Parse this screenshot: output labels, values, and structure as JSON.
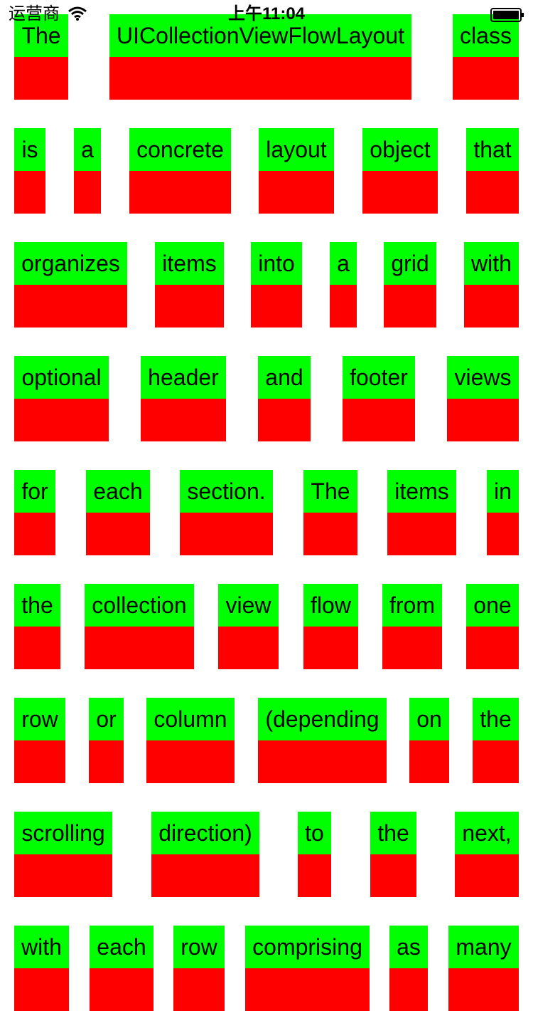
{
  "status_bar": {
    "carrier": "运营商",
    "time": "上午11:04",
    "wifi_icon": "wifi-icon",
    "battery_icon": "battery-icon"
  },
  "collection": {
    "top_color": "#00ff00",
    "bottom_color": "#ff0000",
    "rows": [
      [
        "The",
        "UICollectionViewFlowLayout",
        "class"
      ],
      [
        "is",
        "a",
        "concrete",
        "layout",
        "object",
        "that"
      ],
      [
        "organizes",
        "items",
        "into",
        "a",
        "grid",
        "with"
      ],
      [
        "optional",
        "header",
        "and",
        "footer",
        "views"
      ],
      [
        "for",
        "each",
        "section.",
        "The",
        "items",
        "in"
      ],
      [
        "the",
        "collection",
        "view",
        "flow",
        "from",
        "one"
      ],
      [
        "row",
        "or",
        "column",
        "(depending",
        "on",
        "the"
      ],
      [
        "scrolling",
        "direction)",
        "to",
        "the",
        "next,"
      ],
      [
        "with",
        "each",
        "row",
        "comprising",
        "as",
        "many"
      ]
    ]
  }
}
